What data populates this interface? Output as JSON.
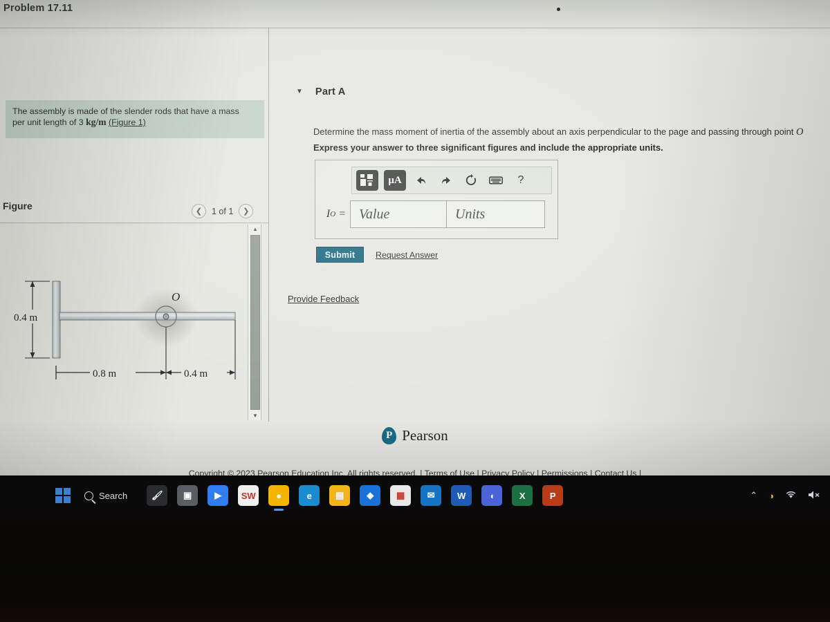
{
  "problem": {
    "title": "Problem 17.11",
    "statement_line1": "The assembly is made of the slender rods that have a mass",
    "statement_line2_pre": "per unit length of 3",
    "statement_units": "kg/m",
    "statement_figure_link": "(Figure 1)"
  },
  "figure": {
    "heading": "Figure",
    "counter": "1 of 1",
    "prev_icon": "chevron-left-icon",
    "next_icon": "chevron-right-icon",
    "diagram": {
      "label_vertical": "0.4 m",
      "label_left_span": "0.8 m",
      "label_right_span": "0.4 m",
      "point_label": "O"
    }
  },
  "part": {
    "caret": "▼",
    "label": "Part A",
    "question": "Determine the mass moment of inertia of the assembly about an axis perpendicular to the page and passing through point",
    "question_point": "O",
    "instruction": "Express your answer to three significant figures and include the appropriate units."
  },
  "answer": {
    "io_label": "I",
    "io_sub": "O",
    "io_equals": "=",
    "value_placeholder": "Value",
    "units_placeholder": "Units",
    "toolbar": [
      {
        "name": "template-math-icon",
        "glyph": ""
      },
      {
        "name": "units-micro-angstrom-icon",
        "glyph": "μA"
      },
      {
        "name": "undo-icon",
        "glyph": "↶"
      },
      {
        "name": "redo-icon",
        "glyph": "↷"
      },
      {
        "name": "reset-icon",
        "glyph": "↺"
      },
      {
        "name": "keyboard-icon",
        "glyph": "⌨"
      },
      {
        "name": "help-icon",
        "glyph": "?"
      }
    ]
  },
  "actions": {
    "submit_label": "Submit",
    "request_answer_label": "Request Answer",
    "provide_feedback_label": "Provide Feedback"
  },
  "footer": {
    "brand_mark": "P",
    "brand_name": "Pearson",
    "copyright": "Copyright © 2023 Pearson Education Inc. All rights reserved.",
    "links": [
      "Terms of Use",
      "Privacy Policy",
      "Permissions",
      "Contact Us"
    ],
    "separator": "|"
  },
  "taskbar": {
    "start_name": "start-button",
    "search_placeholder": "Search",
    "apps": [
      {
        "name": "taskbar-icon-paint",
        "label": "🖌",
        "color": "#2b2c30",
        "running": false
      },
      {
        "name": "taskbar-icon-widgets",
        "label": "▣",
        "color": "#5a5d63",
        "running": false
      },
      {
        "name": "taskbar-icon-zoom",
        "label": "▶",
        "color": "#2f7df0",
        "running": false
      },
      {
        "name": "taskbar-icon-solidworks",
        "label": "SW",
        "color": "#f0f0f0",
        "running": false
      },
      {
        "name": "taskbar-icon-chrome",
        "label": "●",
        "color": "#f5b400",
        "running": true
      },
      {
        "name": "taskbar-icon-edge",
        "label": "e",
        "color": "#1b8bd0",
        "running": false
      },
      {
        "name": "taskbar-icon-file-explorer",
        "label": "▤",
        "color": "#f2b417",
        "running": false
      },
      {
        "name": "taskbar-icon-dropbox",
        "label": "◆",
        "color": "#1a72d8",
        "running": false
      },
      {
        "name": "taskbar-icon-microsoft-store",
        "label": "▦",
        "color": "#e8e8e8",
        "running": false
      },
      {
        "name": "taskbar-icon-mail",
        "label": "✉",
        "color": "#1573c4",
        "running": false
      },
      {
        "name": "taskbar-icon-word",
        "label": "W",
        "color": "#1f5bb5",
        "running": false
      },
      {
        "name": "taskbar-icon-office",
        "label": "◖",
        "color": "#4a63d8",
        "running": false
      },
      {
        "name": "taskbar-icon-excel",
        "label": "X",
        "color": "#1b7043",
        "running": false
      },
      {
        "name": "taskbar-icon-powerpoint",
        "label": "P",
        "color": "#b83c18",
        "running": false
      }
    ],
    "tray": [
      {
        "name": "tray-show-hidden-icon",
        "glyph": "⌃"
      },
      {
        "name": "tray-battery-icon",
        "glyph": "◑"
      },
      {
        "name": "tray-wifi-icon",
        "glyph": "◠"
      },
      {
        "name": "tray-volume-mute-icon",
        "glyph": "🔇"
      }
    ]
  },
  "colors": {
    "accent_submit": "#1c6b83",
    "statement_highlight": "#c6d6cc",
    "page_background": "#e9eae5",
    "pearson_teal": "#176b86"
  }
}
